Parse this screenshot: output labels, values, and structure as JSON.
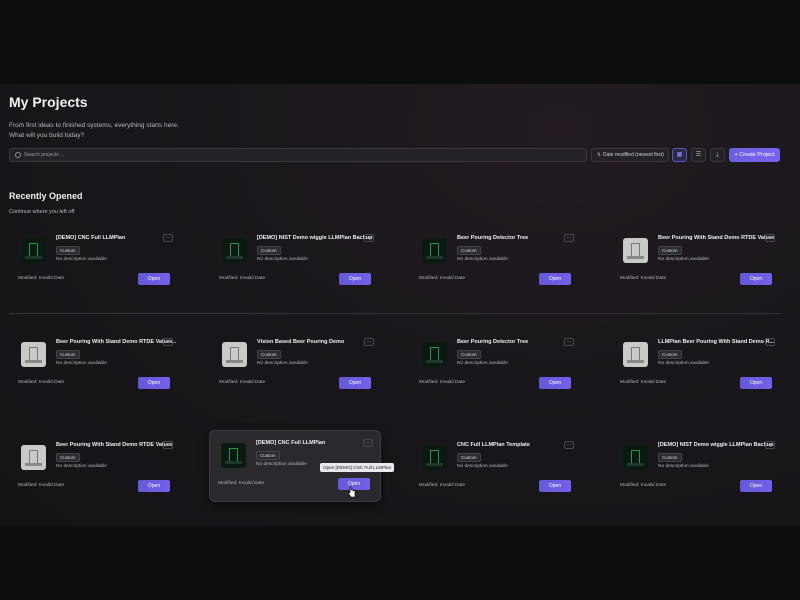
{
  "page": {
    "title": "My Projects",
    "subtitle_line1": "From first ideas to finished systems, everything starts here.",
    "subtitle_line2": "What will you build today?"
  },
  "toolbar": {
    "search_placeholder": "Search projects ...",
    "sort_label": "Date modified (newest first)",
    "create_label": "+ Create Project"
  },
  "icons": {
    "search": "search-icon",
    "sort": "sort-icon",
    "grid": "grid-view-icon",
    "list": "list-view-icon",
    "import": "download-icon",
    "more": "more-horizontal-icon"
  },
  "recent": {
    "title": "Recently Opened",
    "subtitle": "Continue where you left off"
  },
  "common": {
    "badge": "Custom",
    "description": "No description available",
    "modified": "Modified: Invalid Date",
    "open": "Open",
    "more": "…"
  },
  "cards": [
    {
      "title": "[DEMO] CNC Full LLMPlan",
      "thumb": "dark"
    },
    {
      "title": "[DEMO] NIST Demo wiggle LLMPlan Backup",
      "thumb": "dark"
    },
    {
      "title": "Beer Pouring Detector Tree",
      "thumb": "dark"
    },
    {
      "title": "Beer Pouring With Stand Demo RTDE Values",
      "thumb": "light"
    },
    {
      "title": "Beer Pouring With Stand Demo RTDE Values...",
      "thumb": "light"
    },
    {
      "title": "Vision Based Beer Pouring Demo",
      "thumb": "light"
    },
    {
      "title": "Beer Pouring Detector Tree",
      "thumb": "dark"
    },
    {
      "title": "LLMPlan Beer Pouring With Stand Demo R...",
      "thumb": "light"
    },
    {
      "title": "Beer Pouring With Stand Demo RTDE Values",
      "thumb": "light"
    },
    {
      "title": "[DEMO] CNC Full LLMPlan",
      "thumb": "dark"
    },
    {
      "title": "CNC Full LLMPlan Template",
      "thumb": "dark"
    },
    {
      "title": "[DEMO] NIST Demo wiggle LLMPlan Backup",
      "thumb": "dark"
    }
  ],
  "tooltip": "Open [DEMO] CNC Full LLMPlan",
  "colors": {
    "accent": "#6a5fe0",
    "background": "#141316"
  }
}
